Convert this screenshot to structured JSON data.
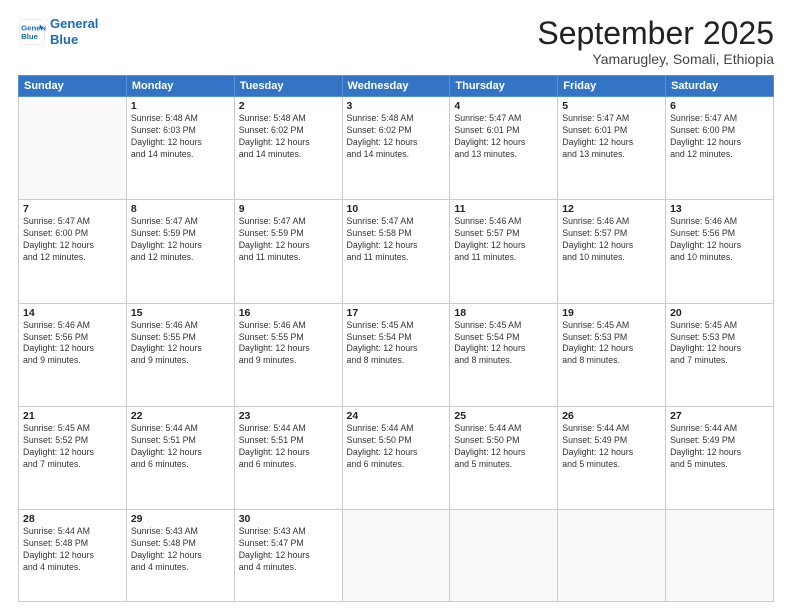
{
  "logo": {
    "line1": "General",
    "line2": "Blue"
  },
  "title": "September 2025",
  "subtitle": "Yamarugley, Somali, Ethiopia",
  "days_of_week": [
    "Sunday",
    "Monday",
    "Tuesday",
    "Wednesday",
    "Thursday",
    "Friday",
    "Saturday"
  ],
  "weeks": [
    [
      {
        "day": "",
        "info": ""
      },
      {
        "day": "1",
        "info": "Sunrise: 5:48 AM\nSunset: 6:03 PM\nDaylight: 12 hours\nand 14 minutes."
      },
      {
        "day": "2",
        "info": "Sunrise: 5:48 AM\nSunset: 6:02 PM\nDaylight: 12 hours\nand 14 minutes."
      },
      {
        "day": "3",
        "info": "Sunrise: 5:48 AM\nSunset: 6:02 PM\nDaylight: 12 hours\nand 14 minutes."
      },
      {
        "day": "4",
        "info": "Sunrise: 5:47 AM\nSunset: 6:01 PM\nDaylight: 12 hours\nand 13 minutes."
      },
      {
        "day": "5",
        "info": "Sunrise: 5:47 AM\nSunset: 6:01 PM\nDaylight: 12 hours\nand 13 minutes."
      },
      {
        "day": "6",
        "info": "Sunrise: 5:47 AM\nSunset: 6:00 PM\nDaylight: 12 hours\nand 12 minutes."
      }
    ],
    [
      {
        "day": "7",
        "info": "Sunrise: 5:47 AM\nSunset: 6:00 PM\nDaylight: 12 hours\nand 12 minutes."
      },
      {
        "day": "8",
        "info": "Sunrise: 5:47 AM\nSunset: 5:59 PM\nDaylight: 12 hours\nand 12 minutes."
      },
      {
        "day": "9",
        "info": "Sunrise: 5:47 AM\nSunset: 5:59 PM\nDaylight: 12 hours\nand 11 minutes."
      },
      {
        "day": "10",
        "info": "Sunrise: 5:47 AM\nSunset: 5:58 PM\nDaylight: 12 hours\nand 11 minutes."
      },
      {
        "day": "11",
        "info": "Sunrise: 5:46 AM\nSunset: 5:57 PM\nDaylight: 12 hours\nand 11 minutes."
      },
      {
        "day": "12",
        "info": "Sunrise: 5:46 AM\nSunset: 5:57 PM\nDaylight: 12 hours\nand 10 minutes."
      },
      {
        "day": "13",
        "info": "Sunrise: 5:46 AM\nSunset: 5:56 PM\nDaylight: 12 hours\nand 10 minutes."
      }
    ],
    [
      {
        "day": "14",
        "info": "Sunrise: 5:46 AM\nSunset: 5:56 PM\nDaylight: 12 hours\nand 9 minutes."
      },
      {
        "day": "15",
        "info": "Sunrise: 5:46 AM\nSunset: 5:55 PM\nDaylight: 12 hours\nand 9 minutes."
      },
      {
        "day": "16",
        "info": "Sunrise: 5:46 AM\nSunset: 5:55 PM\nDaylight: 12 hours\nand 9 minutes."
      },
      {
        "day": "17",
        "info": "Sunrise: 5:45 AM\nSunset: 5:54 PM\nDaylight: 12 hours\nand 8 minutes."
      },
      {
        "day": "18",
        "info": "Sunrise: 5:45 AM\nSunset: 5:54 PM\nDaylight: 12 hours\nand 8 minutes."
      },
      {
        "day": "19",
        "info": "Sunrise: 5:45 AM\nSunset: 5:53 PM\nDaylight: 12 hours\nand 8 minutes."
      },
      {
        "day": "20",
        "info": "Sunrise: 5:45 AM\nSunset: 5:53 PM\nDaylight: 12 hours\nand 7 minutes."
      }
    ],
    [
      {
        "day": "21",
        "info": "Sunrise: 5:45 AM\nSunset: 5:52 PM\nDaylight: 12 hours\nand 7 minutes."
      },
      {
        "day": "22",
        "info": "Sunrise: 5:44 AM\nSunset: 5:51 PM\nDaylight: 12 hours\nand 6 minutes."
      },
      {
        "day": "23",
        "info": "Sunrise: 5:44 AM\nSunset: 5:51 PM\nDaylight: 12 hours\nand 6 minutes."
      },
      {
        "day": "24",
        "info": "Sunrise: 5:44 AM\nSunset: 5:50 PM\nDaylight: 12 hours\nand 6 minutes."
      },
      {
        "day": "25",
        "info": "Sunrise: 5:44 AM\nSunset: 5:50 PM\nDaylight: 12 hours\nand 5 minutes."
      },
      {
        "day": "26",
        "info": "Sunrise: 5:44 AM\nSunset: 5:49 PM\nDaylight: 12 hours\nand 5 minutes."
      },
      {
        "day": "27",
        "info": "Sunrise: 5:44 AM\nSunset: 5:49 PM\nDaylight: 12 hours\nand 5 minutes."
      }
    ],
    [
      {
        "day": "28",
        "info": "Sunrise: 5:44 AM\nSunset: 5:48 PM\nDaylight: 12 hours\nand 4 minutes."
      },
      {
        "day": "29",
        "info": "Sunrise: 5:43 AM\nSunset: 5:48 PM\nDaylight: 12 hours\nand 4 minutes."
      },
      {
        "day": "30",
        "info": "Sunrise: 5:43 AM\nSunset: 5:47 PM\nDaylight: 12 hours\nand 4 minutes."
      },
      {
        "day": "",
        "info": ""
      },
      {
        "day": "",
        "info": ""
      },
      {
        "day": "",
        "info": ""
      },
      {
        "day": "",
        "info": ""
      }
    ]
  ]
}
